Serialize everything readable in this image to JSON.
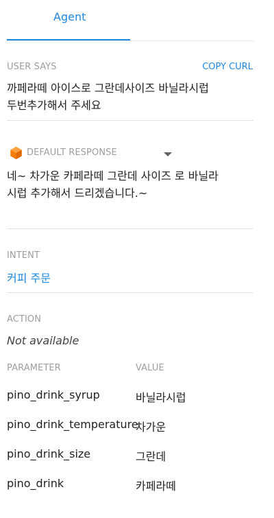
{
  "tab": {
    "label": "Agent"
  },
  "user_says": {
    "label": "USER SAYS",
    "copy_label": "COPY CURL",
    "lines": [
      "까페라떼 아이스로 그란데사이즈 바닐라시럽",
      "두번추가해서 주세요"
    ]
  },
  "response": {
    "label": "DEFAULT RESPONSE",
    "lines": [
      "네~ 차가운 카페라떼 그란데 사이즈 로 바닐라",
      "시럽 추가해서 드리겠습니다.~"
    ]
  },
  "intent": {
    "label": "INTENT",
    "value": "커피 주문"
  },
  "action": {
    "label": "ACTION",
    "value": "Not available"
  },
  "params": {
    "header_name": "PARAMETER",
    "header_value": "VALUE",
    "rows": [
      {
        "name": "pino_drink_syrup",
        "value": "바닐라시럽"
      },
      {
        "name": "pino_drink_temperature",
        "value": "차가운"
      },
      {
        "name": "pino_drink_size",
        "value": "그란데"
      },
      {
        "name": "pino_drink",
        "value": "카페라떼"
      }
    ]
  },
  "colors": {
    "accent": "#1e88e5",
    "response_icon": "#f57c00"
  }
}
